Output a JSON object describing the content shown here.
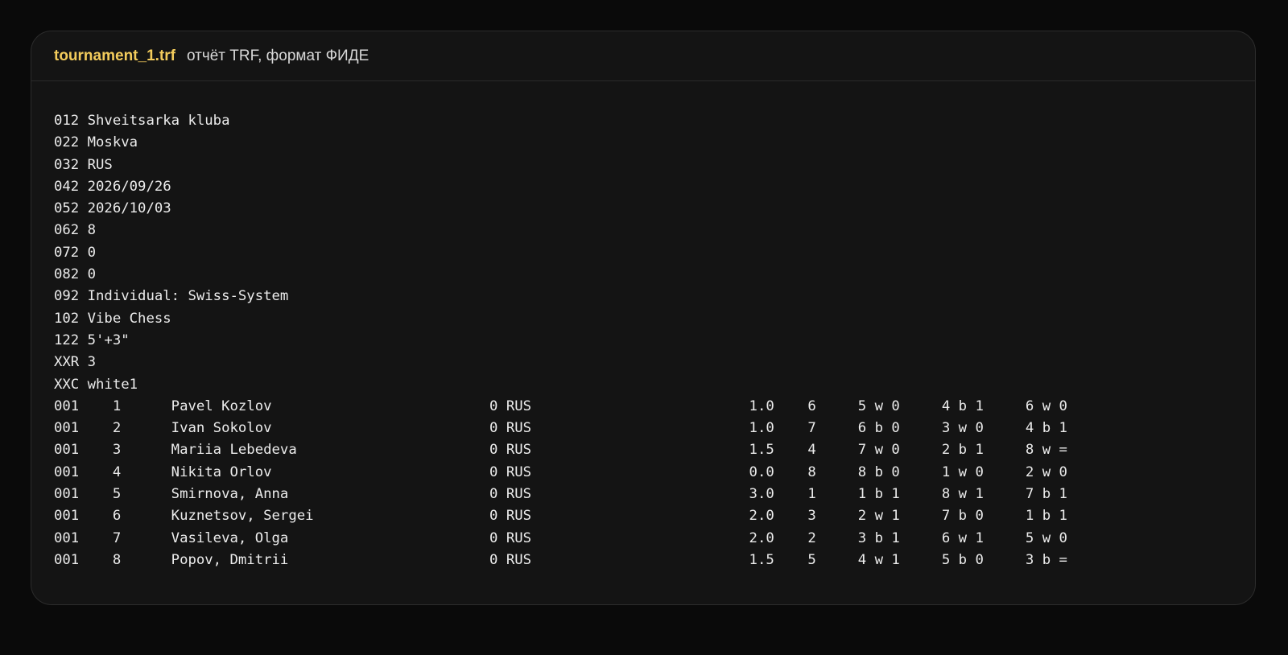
{
  "header": {
    "filename": "tournament_1.trf",
    "subtitle": "отчёт TRF, формат ФИДЕ"
  },
  "lines": [
    "012 Shveitsarka kluba",
    "022 Moskva",
    "032 RUS",
    "042 2026/09/26",
    "052 2026/10/03",
    "062 8",
    "072 0",
    "082 0",
    "092 Individual: Swiss-System",
    "102 Vibe Chess",
    "122 5'+3\"",
    "XXR 3",
    "XXC white1",
    "001    1      Pavel Kozlov                          0 RUS                          1.0    6     5 w 0     4 b 1     6 w 0",
    "001    2      Ivan Sokolov                          0 RUS                          1.0    7     6 b 0     3 w 0     4 b 1",
    "001    3      Mariia Lebedeva                       0 RUS                          1.5    4     7 w 0     2 b 1     8 w =",
    "001    4      Nikita Orlov                          0 RUS                          0.0    8     8 b 0     1 w 0     2 w 0",
    "001    5      Smirnova, Anna                        0 RUS                          3.0    1     1 b 1     8 w 1     7 b 1",
    "001    6      Kuznetsov, Sergei                     0 RUS                          2.0    3     2 w 1     7 b 0     1 b 1",
    "001    7      Vasileva, Olga                        0 RUS                          2.0    2     3 b 1     6 w 1     5 w 0",
    "001    8      Popov, Dmitrii                        0 RUS                          1.5    5     4 w 1     5 b 0     3 b ="
  ]
}
